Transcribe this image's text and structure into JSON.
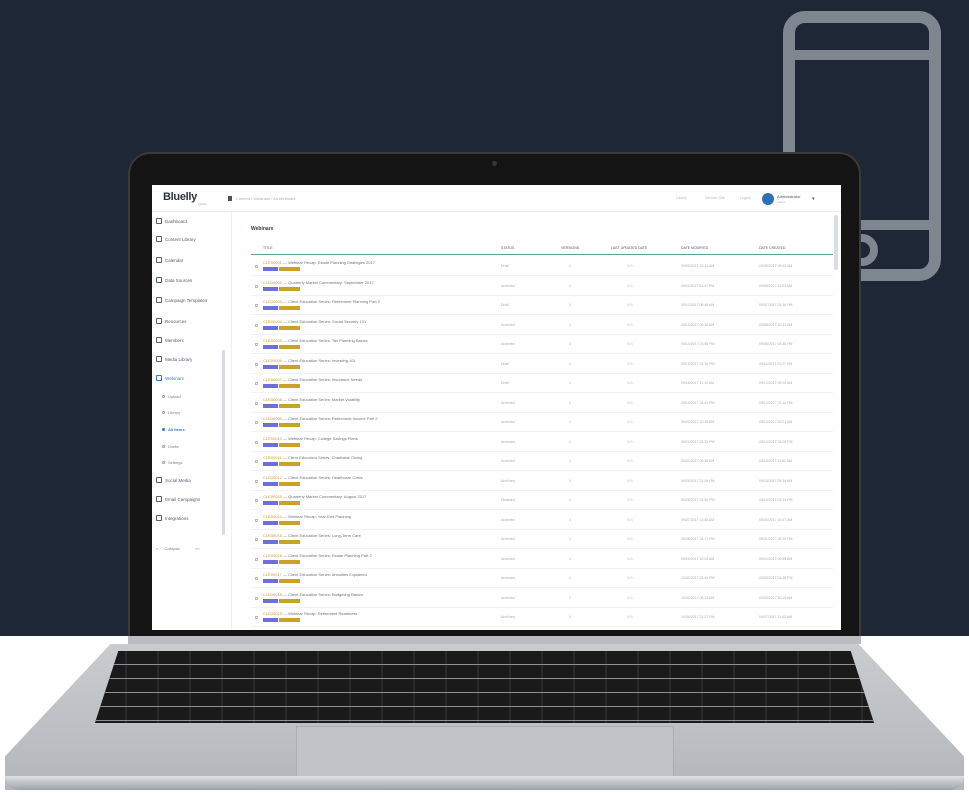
{
  "app": {
    "brand": "Bluelly",
    "brand_sub": "Library",
    "breadcrumb": "Content / Webinars / All Webinars",
    "topbar_links": [
      "Library",
      "Member Site",
      "Logout"
    ],
    "user": {
      "name": "Administrator",
      "sub": "Admin"
    }
  },
  "sidebar": {
    "items": [
      {
        "label": "Dashboard",
        "icon": "dashboard-icon"
      },
      {
        "label": "Content Library",
        "icon": "library-icon"
      },
      {
        "label": "Calendar",
        "icon": "calendar-icon"
      },
      {
        "label": "Data Sources",
        "icon": "database-icon"
      },
      {
        "label": "Campaign Templates",
        "icon": "template-icon"
      },
      {
        "label": "Resources",
        "icon": "resource-icon"
      },
      {
        "label": "Members",
        "icon": "members-icon"
      },
      {
        "label": "Media Library",
        "icon": "media-icon"
      },
      {
        "label": "Webinars",
        "icon": "webinar-icon"
      }
    ],
    "sub_items": [
      "Upload",
      "Library",
      "All Items",
      "Drafts",
      "Settings"
    ],
    "items_after": [
      {
        "label": "Social Media",
        "icon": "social-icon"
      },
      {
        "label": "Email Campaigns",
        "icon": "email-icon"
      },
      {
        "label": "Integrations",
        "icon": "integrations-icon"
      }
    ],
    "collapse_label": "Collapse",
    "collapse_key": "<<"
  },
  "main": {
    "heading": "Webinars",
    "columns": [
      "Title",
      "Status",
      "Versions",
      "Last Updated Date",
      "Date Modified",
      "Date Created"
    ],
    "rows": [
      {
        "id": "CLE00001",
        "title": "Webinar Recap: Estate Planning Strategies 2017",
        "status": "Draft",
        "versions": "1",
        "published": "N/A",
        "modified": "09/05/2017 10:14 AM",
        "created": "09/05/2017 09:40 AM"
      },
      {
        "id": "CLE00002",
        "title": "Quarterly Market Commentary: September 2017",
        "status": "Archived",
        "versions": "4",
        "published": "N/A",
        "modified": "09/11/2017 03:47 PM",
        "created": "09/06/2017 11:04 AM"
      },
      {
        "id": "CLE00003",
        "title": "Client Education Series: Retirement Planning Part 2",
        "status": "Draft",
        "versions": "2",
        "published": "N/A",
        "modified": "09/12/2017 08:46 AM",
        "created": "09/07/2017 02:16 PM"
      },
      {
        "id": "CLE00004",
        "title": "Client Education Series: Social Security 101",
        "status": "Archived",
        "versions": "1",
        "published": "N/A",
        "modified": "09/13/2017 09:30 AM",
        "created": "09/08/2017 10:31 AM"
      },
      {
        "id": "CLE00005",
        "title": "Client Education Series: Tax Planning Basics",
        "status": "Archived",
        "versions": "3",
        "published": "N/A",
        "modified": "09/14/2017 01:55 PM",
        "created": "09/08/2017 03:46 PM"
      },
      {
        "id": "CLE00006",
        "title": "Client Education Series: Investing 101",
        "status": "Draft",
        "versions": "1",
        "published": "N/A",
        "modified": "09/15/2017 02:16 PM",
        "created": "09/11/2017 02:27 PM"
      },
      {
        "id": "CLE00007",
        "title": "Client Education Series: Insurance Needs",
        "status": "Draft",
        "versions": "1",
        "published": "N/A",
        "modified": "09/18/2017 11:10 AM",
        "created": "09/12/2017 09:02 AM"
      },
      {
        "id": "CLE00008",
        "title": "Client Education Series: Market Volatility",
        "status": "Archived",
        "versions": "2",
        "published": "N/A",
        "modified": "09/19/2017 04:41 PM",
        "created": "09/12/2017 01:12 PM"
      },
      {
        "id": "CLE00009",
        "title": "Client Education Series: Retirement Income Part 2",
        "status": "Archived",
        "versions": "1",
        "published": "N/A",
        "modified": "09/20/2017 10:25 AM",
        "created": "09/13/2017 10:21 AM"
      },
      {
        "id": "CLE00010",
        "title": "Webinar Recap: College Savings Plans",
        "status": "Archived",
        "versions": "4",
        "published": "N/A",
        "modified": "09/21/2017 03:33 PM",
        "created": "09/14/2017 04:05 PM"
      },
      {
        "id": "CLE00011",
        "title": "Client Education Series: Charitable Giving",
        "status": "Archived",
        "versions": "1",
        "published": "N/A",
        "modified": "09/22/2017 09:48 AM",
        "created": "09/15/2017 11:52 AM"
      },
      {
        "id": "CLE00012",
        "title": "Client Education Series: Healthcare Costs",
        "status": "Archived",
        "versions": "3",
        "published": "N/A",
        "modified": "09/25/2017 01:09 PM",
        "created": "09/18/2017 09:34 AM"
      },
      {
        "id": "CLE00013",
        "title": "Quarterly Market Commentary: August 2017",
        "status": "Disabled",
        "versions": "1",
        "published": "N/A",
        "modified": "09/26/2017 02:50 PM",
        "created": "09/19/2017 02:13 PM"
      },
      {
        "id": "CLE00014",
        "title": "Webinar Recap: Year-End Planning",
        "status": "Archived",
        "versions": "2",
        "published": "N/A",
        "modified": "09/27/2017 11:38 AM",
        "created": "09/20/2017 10:47 AM"
      },
      {
        "id": "CLE00015",
        "title": "Client Education Series: Long-Term Care",
        "status": "Archived",
        "versions": "1",
        "published": "N/A",
        "modified": "09/28/2017 04:17 PM",
        "created": "09/21/2017 03:29 PM"
      },
      {
        "id": "CLE00016",
        "title": "Client Education Series: Estate Planning Part 2",
        "status": "Archived",
        "versions": "4",
        "published": "N/A",
        "modified": "09/29/2017 10:02 AM",
        "created": "09/22/2017 09:55 AM"
      },
      {
        "id": "CLE00017",
        "title": "Client Education Series: Annuities Explained",
        "status": "Archived",
        "versions": "1",
        "published": "N/A",
        "modified": "10/02/2017 03:44 PM",
        "created": "09/25/2017 01:38 PM"
      },
      {
        "id": "CLE00018",
        "title": "Client Education Series: Budgeting Basics",
        "status": "Archived",
        "versions": "2",
        "published": "N/A",
        "modified": "10/03/2017 09:12 AM",
        "created": "09/26/2017 10:16 AM"
      },
      {
        "id": "CLE00019",
        "title": "Webinar Recap: Retirement Readiness",
        "status": "Archived",
        "versions": "4",
        "published": "N/A",
        "modified": "10/04/2017 01:27 PM",
        "created": "09/27/2017 11:43 AM"
      },
      {
        "id": "CLE00020",
        "title": "Quarterly Market Commentary: August 2017",
        "status": "Archived",
        "versions": "1",
        "published": "N/A",
        "modified": "10/05/2017 04:30 PM",
        "created": "09/28/2017 02:08 PM"
      }
    ]
  },
  "colors": {
    "backdrop": "#1d2736",
    "accent_teal": "#5aa3a1",
    "tag_purple": "#6f6fd9",
    "tag_gold": "#c9a227",
    "link_blue": "#3a7bc8"
  },
  "decor": {
    "phone_icon": "mobile-phone-icon"
  }
}
